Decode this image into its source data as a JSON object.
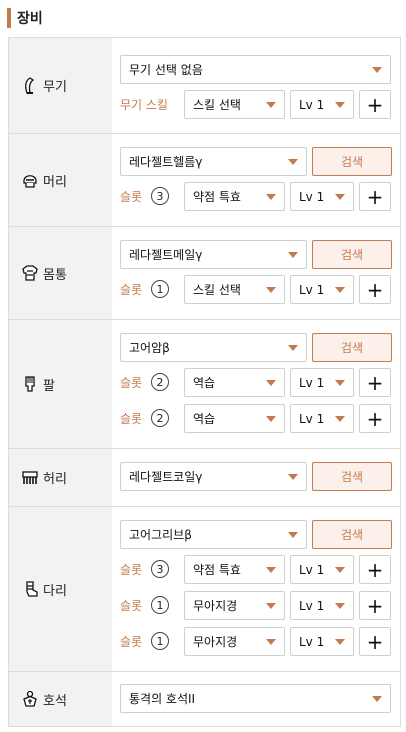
{
  "header": {
    "title": "장비"
  },
  "labels": {
    "slot": "슬롯",
    "weapon_skill": "무기 스킬",
    "search": "검색",
    "plus": "+"
  },
  "rows": {
    "weapon": {
      "name": "무기",
      "select": "무기 선택 없음",
      "skill": "스킬 선택",
      "level": "Lv 1"
    },
    "head": {
      "name": "머리",
      "select": "레다젤트헬름γ",
      "slots": [
        {
          "n": "3",
          "skill": "약점 특효",
          "level": "Lv 1"
        }
      ]
    },
    "body": {
      "name": "몸통",
      "select": "레다젤트메일γ",
      "slots": [
        {
          "n": "1",
          "skill": "스킬 선택",
          "level": "Lv 1"
        }
      ]
    },
    "arms": {
      "name": "팔",
      "select": "고어암β",
      "slots": [
        {
          "n": "2",
          "skill": "역습",
          "level": "Lv 1"
        },
        {
          "n": "2",
          "skill": "역습",
          "level": "Lv 1"
        }
      ]
    },
    "waist": {
      "name": "허리",
      "select": "레다젤트코일γ"
    },
    "legs": {
      "name": "다리",
      "select": "고어그리브β",
      "slots": [
        {
          "n": "3",
          "skill": "약점 특효",
          "level": "Lv 1"
        },
        {
          "n": "1",
          "skill": "무아지경",
          "level": "Lv 1"
        },
        {
          "n": "1",
          "skill": "무아지경",
          "level": "Lv 1"
        }
      ]
    },
    "charm": {
      "name": "호석",
      "select": "통격의 호석II"
    }
  },
  "colors": {
    "accent": "#c47a4f",
    "label_bg": "#f2f2f2",
    "border": "#dcdcdc"
  }
}
